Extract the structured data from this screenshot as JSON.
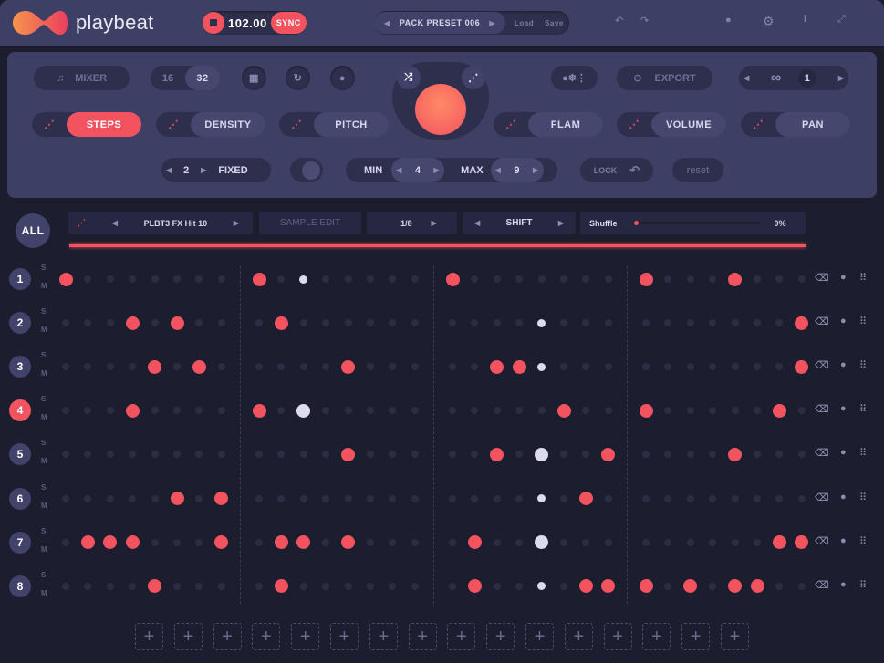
{
  "app": {
    "name": "playbeat"
  },
  "transport": {
    "tempo": "102.00",
    "sync_label": "SYNC"
  },
  "preset": {
    "name": "PACK PRESET 006",
    "load_label": "Load",
    "save_label": "Save"
  },
  "panel": {
    "mixer_label": "MIXER",
    "steps16": "16",
    "steps32": "32",
    "export_label": "EXPORT",
    "loop_count": "1",
    "modes": [
      {
        "label": "STEPS",
        "active": true
      },
      {
        "label": "DENSITY"
      },
      {
        "label": "PITCH"
      },
      {
        "label": "FLAM"
      },
      {
        "label": "VOLUME"
      },
      {
        "label": "PAN"
      }
    ],
    "fixed_value": "2",
    "fixed_label": "FIXED",
    "min_label": "MIN",
    "min_value": "4",
    "max_label": "MAX",
    "max_value": "9",
    "lock_label": "LOCK",
    "reset_label": "reset"
  },
  "track_bar": {
    "all_label": "ALL",
    "sample": "PLBT3 FX Hit 10",
    "sample_edit_label": "SAMPLE EDIT",
    "division": "1/8",
    "shift_label": "SHIFT",
    "shuffle_label": "Shuffle",
    "shuffle_value": "0%",
    "shuffle_fraction": 0
  },
  "colors": {
    "accent": "#f2535f",
    "on_white": "#dcdcec",
    "off": "#2c2d45"
  },
  "tracks": [
    {
      "num": "1",
      "solo": "S",
      "mute": "M",
      "red": [
        0,
        8,
        16,
        24,
        28
      ],
      "white_small": [
        10
      ],
      "white_large": []
    },
    {
      "num": "2",
      "solo": "S",
      "mute": "M",
      "red": [
        3,
        5,
        9,
        31
      ],
      "white_small": [
        20
      ],
      "white_large": []
    },
    {
      "num": "3",
      "solo": "S",
      "mute": "M",
      "red": [
        4,
        6,
        12,
        18,
        19,
        31
      ],
      "white_small": [
        20
      ],
      "white_large": []
    },
    {
      "num": "4",
      "solo": "S",
      "mute": "M",
      "selected": true,
      "red": [
        3,
        8,
        21,
        24,
        30
      ],
      "white_small": [],
      "white_large": [
        10
      ]
    },
    {
      "num": "5",
      "solo": "S",
      "mute": "M",
      "red": [
        12,
        18,
        23,
        28
      ],
      "white_small": [],
      "white_large": [
        20
      ]
    },
    {
      "num": "6",
      "solo": "S",
      "mute": "M",
      "red": [
        5,
        7,
        22
      ],
      "white_small": [
        20
      ],
      "white_large": []
    },
    {
      "num": "7",
      "solo": "S",
      "mute": "M",
      "red": [
        1,
        2,
        3,
        7,
        9,
        10,
        12,
        17,
        30,
        31
      ],
      "white_small": [],
      "white_large": [
        20
      ]
    },
    {
      "num": "8",
      "solo": "S",
      "mute": "M",
      "red": [
        4,
        9,
        17,
        22,
        23,
        24,
        26,
        28,
        29
      ],
      "white_small": [
        20
      ],
      "white_large": []
    }
  ],
  "add_slots": 16,
  "add_label": "+"
}
